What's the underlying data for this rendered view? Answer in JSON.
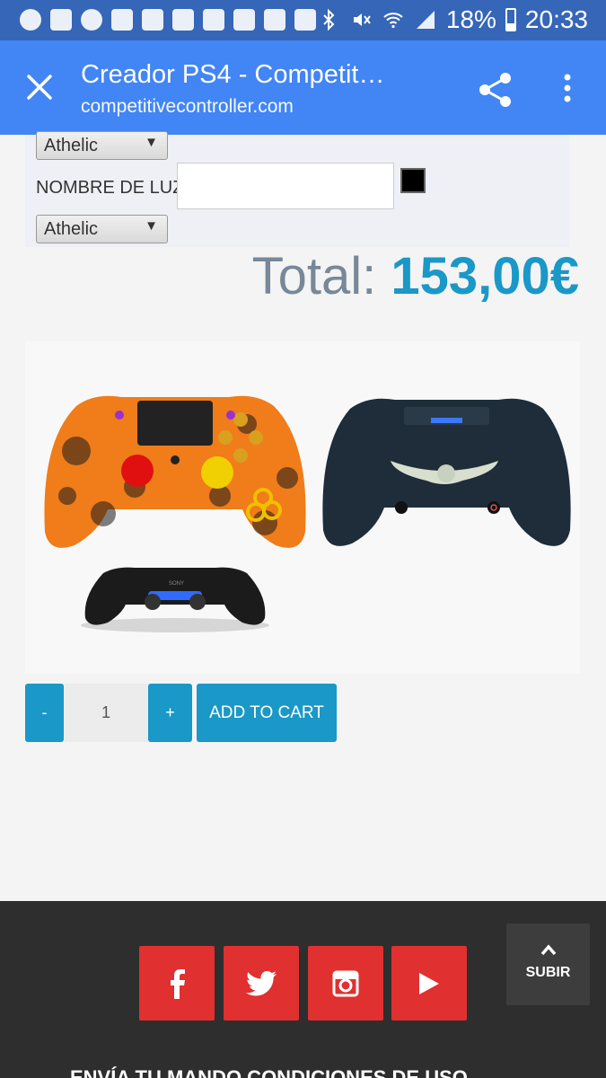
{
  "status_bar": {
    "battery": "18%",
    "time": "20:33",
    "icons": [
      "chat-icon",
      "facebook-icon",
      "whatsapp-icon",
      "image-icon",
      "twitter-icon",
      "twitter-icon",
      "gmail-icon",
      "twitter-icon",
      "instagram-icon",
      "youtube-icon",
      "bluetooth-icon",
      "mute-icon",
      "wifi-icon",
      "signal-icon",
      "battery-icon"
    ]
  },
  "toolbar": {
    "title": "Creador PS4 - Competit…",
    "url": "competitivecontroller.com"
  },
  "options": {
    "select1_value": "Athelic",
    "light_label": "NOMBRE DE LUZ:",
    "light_value": "",
    "swatch_color": "#000000",
    "select2_value": "Athelic"
  },
  "total": {
    "label": "Total:",
    "value": "153,00€"
  },
  "product": {
    "brand_mark": "SONY"
  },
  "cart": {
    "minus_label": "-",
    "quantity": "1",
    "plus_label": "+",
    "add_label": "ADD TO CART"
  },
  "footer": {
    "subir_label": "SUBIR",
    "links_text": "ENVÍA TU MANDO   CONDICIONES DE USO"
  },
  "colors": {
    "accent": "#1a98c8",
    "toolbar": "#4285f4",
    "social": "#e03030"
  }
}
